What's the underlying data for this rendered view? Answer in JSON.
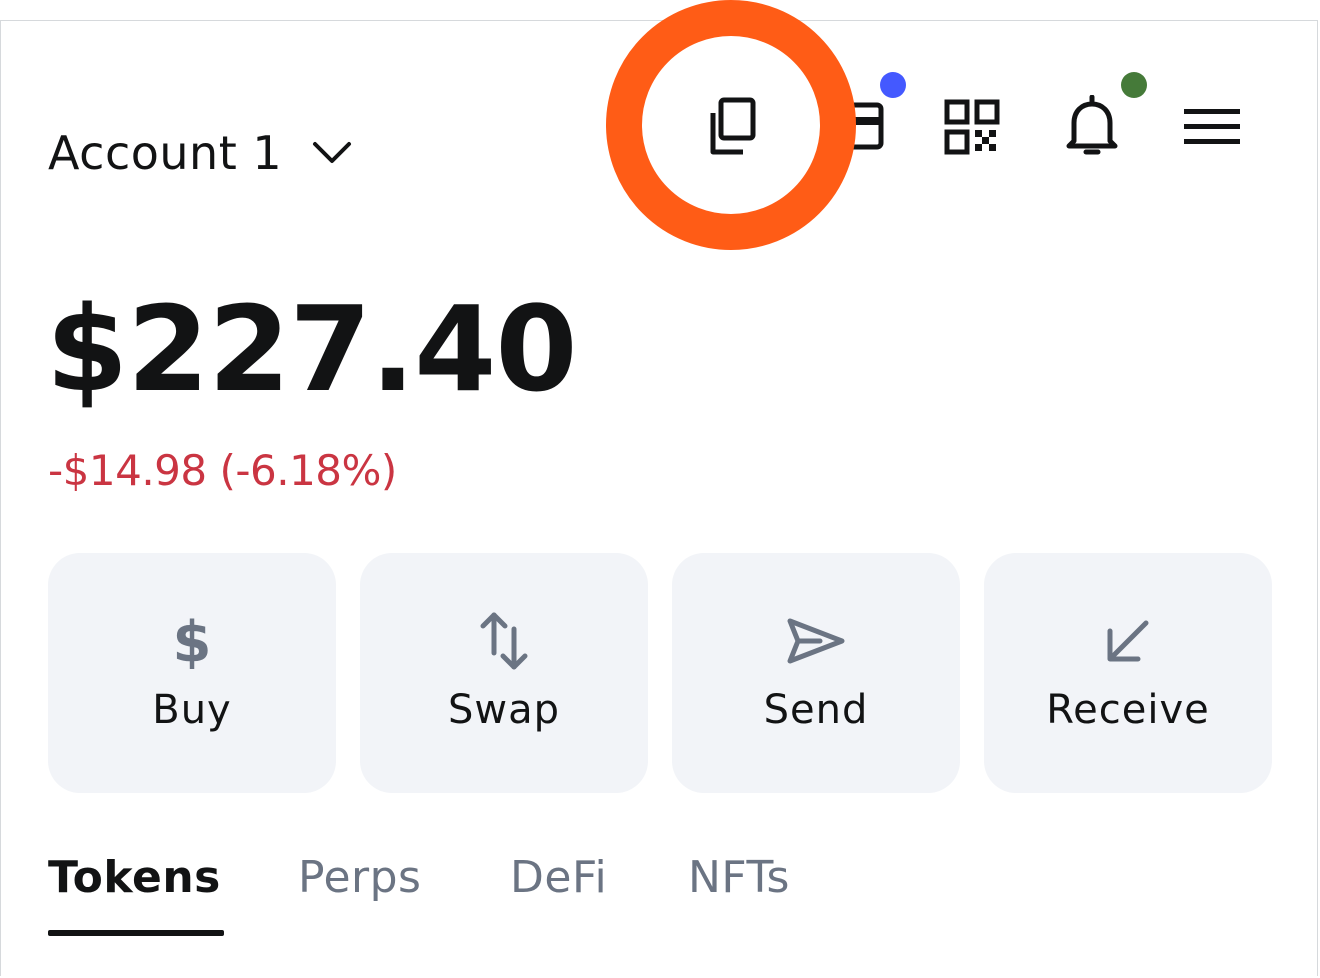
{
  "header": {
    "account_name": "Account 1"
  },
  "balance": {
    "total": "$227.40",
    "change": "-$14.98 (-6.18%)"
  },
  "actions": [
    {
      "label": "Buy",
      "icon": "dollar-icon"
    },
    {
      "label": "Swap",
      "icon": "swap-arrows-icon"
    },
    {
      "label": "Send",
      "icon": "send-icon"
    },
    {
      "label": "Receive",
      "icon": "receive-arrow-icon"
    }
  ],
  "tabs": [
    {
      "label": "Tokens",
      "active": true
    },
    {
      "label": "Perps",
      "active": false
    },
    {
      "label": "DeFi",
      "active": false
    },
    {
      "label": "NFTs",
      "active": false
    }
  ],
  "colors": {
    "accent_ring": "#ff5c16",
    "negative": "#ca3542",
    "badge_blue": "#4459ff",
    "badge_green": "#457a39",
    "action_bg": "#f2f4f8",
    "muted_icon": "#6b7483"
  }
}
